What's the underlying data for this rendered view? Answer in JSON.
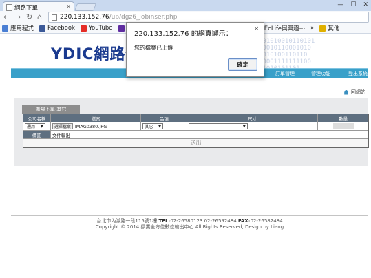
{
  "browser": {
    "tab_title": "網路下單",
    "url_host": "220.133.152.76",
    "url_path": "/up/dgz6_jobinser.php",
    "bookmarks": [
      {
        "label": "應用程式",
        "icon": "apps-icon",
        "color": "#4a7fd4"
      },
      {
        "label": "Facebook",
        "icon": "facebook-icon",
        "color": "#3b5998"
      },
      {
        "label": "YouTube",
        "icon": "youtube-icon",
        "color": "#e52d27"
      },
      {
        "label": "Ya",
        "icon": "yahoo-icon",
        "color": "#5f2da1"
      },
      {
        "label": "數⋯",
        "icon": "bookmark-icon",
        "color": "#888888"
      },
      {
        "label": "EcLife與興趣⋯",
        "icon": "eclife-icon",
        "color": "#2a8fd8"
      },
      {
        "label": "»",
        "icon": "more-icon",
        "color": "#555555"
      },
      {
        "label": "其他",
        "icon": "folder-icon",
        "color": "#e0b000"
      }
    ]
  },
  "site": {
    "logo": "YDIC網路傳",
    "binary_text": "101010010110101\n10010110001010\n1010100110110\n10001111111100\n11010101101",
    "menu": [
      "訂單管理",
      "管理功能",
      "登出系統"
    ],
    "back_link": "回網站"
  },
  "form": {
    "tab_label": "搬場下單-其它",
    "headers": [
      "公司名稱",
      "檔案",
      "品項",
      "尺寸",
      "數量"
    ],
    "company_value": "通用",
    "file_button": "選擇檔案",
    "file_name": "IMAG0380.JPG",
    "item_value": "其它",
    "size_value": "",
    "remark_label": "備註",
    "remark_value": "文件輸出",
    "submit_label": "送出"
  },
  "footer": {
    "address": "台北市內湖路一段115號1樓",
    "tel_label": "TEL:",
    "tel_value": "02-26580123 02-26592484",
    "fax_label": "FAX:",
    "fax_value": "02-26582484",
    "copyright": "Copyright © 2014 鼎業全方位數位輸出中心 All Rights Reserved, Design by Liang"
  },
  "dialog": {
    "title": "220.133.152.76 的網頁顯示：",
    "message": "您的檔案已上傳",
    "ok_label": "確定"
  }
}
